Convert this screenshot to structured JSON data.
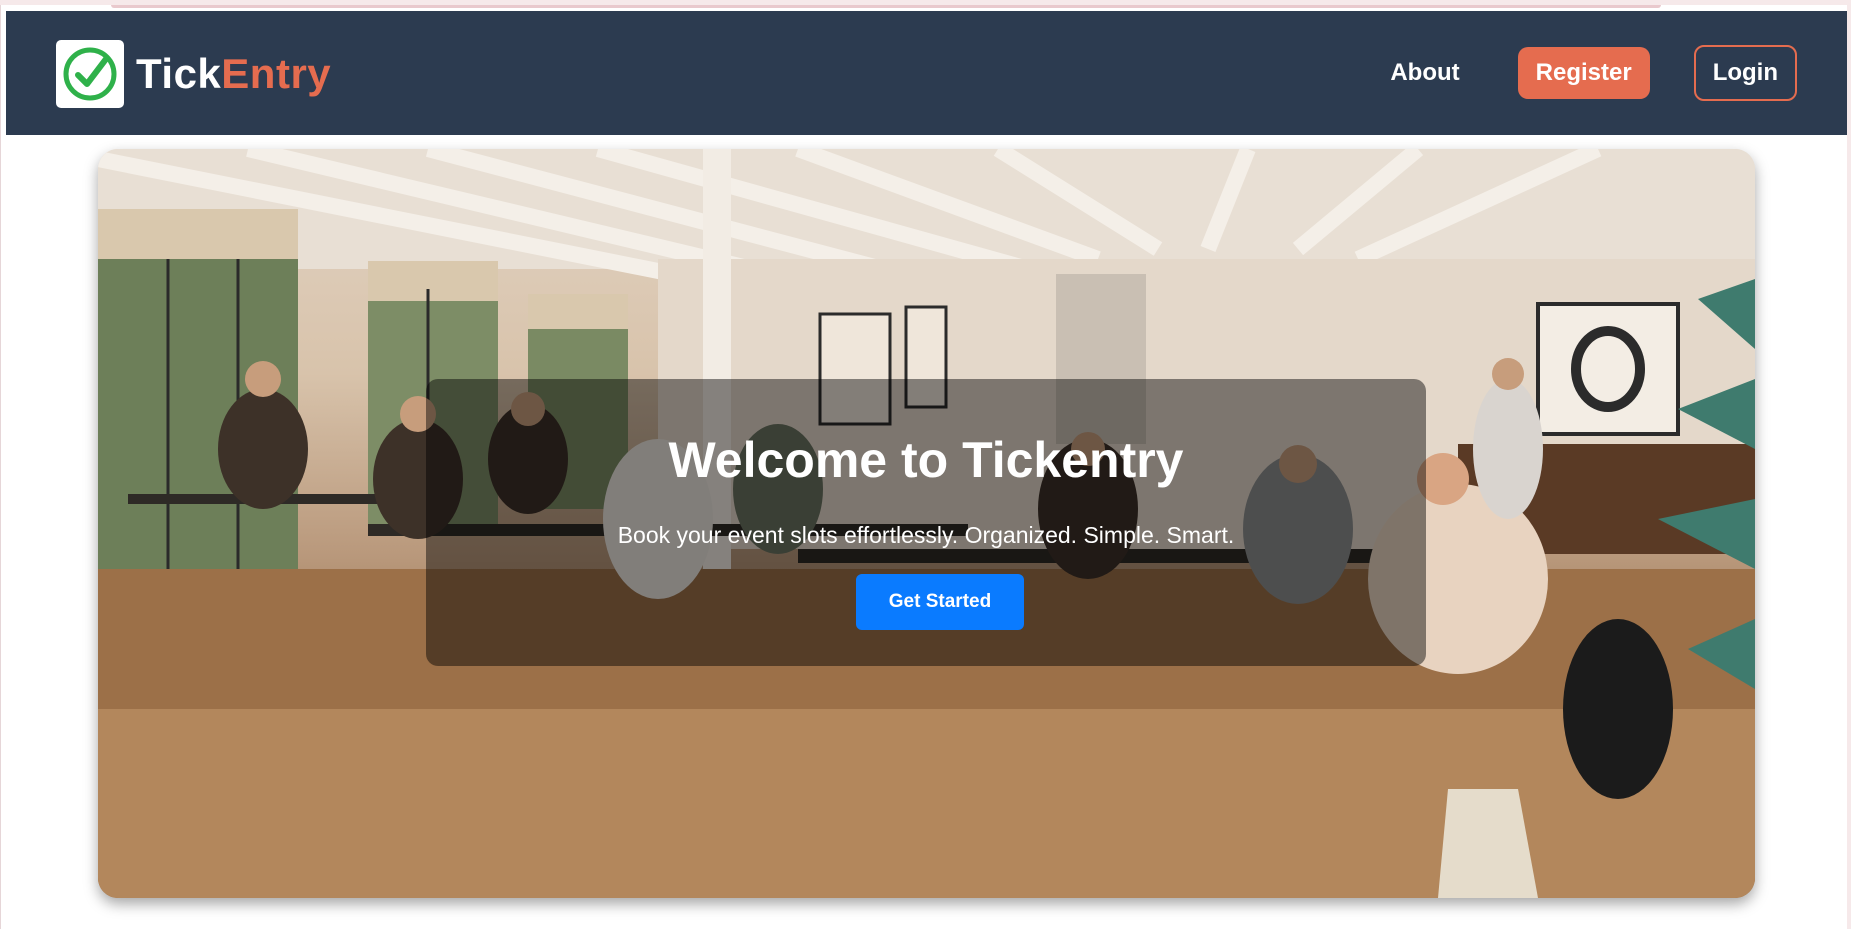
{
  "header": {
    "brand_part1": "Tick",
    "brand_part2": "Entry",
    "logo_icon": "checkmark-circle-icon",
    "nav": {
      "about": "About",
      "register": "Register",
      "login": "Login"
    }
  },
  "hero": {
    "title": "Welcome to Tickentry",
    "subtitle": "Book your event slots effortlessly. Organized. Simple. Smart.",
    "cta": "Get Started",
    "image_description": "event room photo"
  },
  "colors": {
    "navbar_bg": "#2c3b50",
    "accent": "#e56c4f",
    "cta_blue": "#0a7bff",
    "logo_check": "#2fb14a"
  }
}
